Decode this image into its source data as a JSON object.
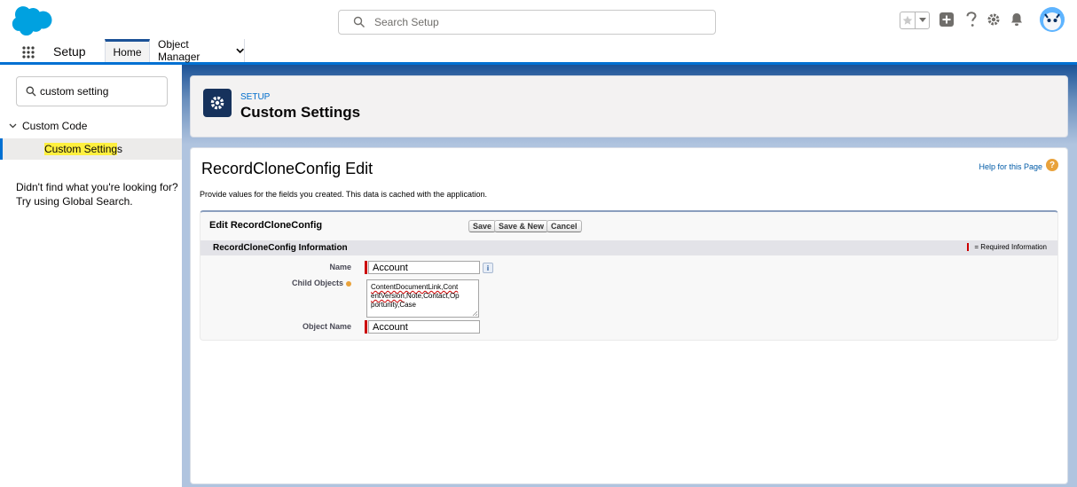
{
  "header": {
    "search_placeholder": "Search Setup",
    "brand_color": "#00a1e0"
  },
  "nav": {
    "app_name": "Setup",
    "tabs": [
      {
        "label": "Home",
        "active": true
      },
      {
        "label": "Object Manager",
        "has_dropdown": true
      }
    ]
  },
  "sidebar": {
    "search_value": "custom setting",
    "group_label": "Custom Code",
    "item_highlight": "Custom Setting",
    "item_rest": "s",
    "not_found_line1": "Didn't find what you're looking for?",
    "not_found_line2": "Try using Global Search."
  },
  "page_header": {
    "kicker": "SETUP",
    "title": "Custom Settings"
  },
  "edit": {
    "title": "RecordCloneConfig Edit",
    "help_link": "Help for this Page",
    "instructions": "Provide values for the fields you created. This data is cached with the application.",
    "block_title": "Edit RecordCloneConfig",
    "buttons": {
      "save": "Save",
      "save_new": "Save & New",
      "cancel": "Cancel"
    },
    "section_title": "RecordCloneConfig Information",
    "required_legend": "= Required Information",
    "fields": {
      "name": {
        "label": "Name",
        "value": "Account"
      },
      "child_objects": {
        "label": "Child Objects",
        "line1": "ContentDocumentLink,Cont",
        "line2a": "entVersion",
        "line2b": ",Note,Contact,Op",
        "line3": "portunity,Case"
      },
      "object_name": {
        "label": "Object Name",
        "value": "Account"
      }
    }
  }
}
